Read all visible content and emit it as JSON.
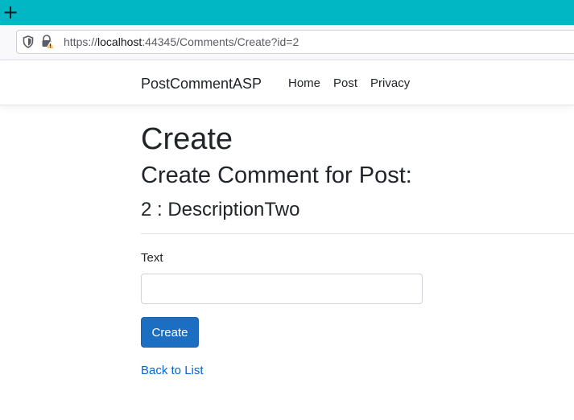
{
  "browser": {
    "new_tab_symbol": "+",
    "url_prefix": "https://",
    "url_host": "localhost",
    "url_rest": ":44345/Comments/Create?id=2",
    "icons": [
      "shield-icon",
      "lock-warning-icon",
      "plus-icon"
    ],
    "colors": {
      "tab_strip": "#00b7c3"
    }
  },
  "navbar": {
    "brand": "PostCommentASP",
    "links": [
      "Home",
      "Post",
      "Privacy"
    ]
  },
  "main": {
    "heading": "Create",
    "subheading": "Create Comment for Post:",
    "post_label": "2 : DescriptionTwo",
    "text_label": "Text",
    "text_value": "",
    "create_button": "Create",
    "back_link": "Back to List",
    "colors": {
      "primary_button": "#1b6ec2",
      "link": "#0366d6"
    }
  }
}
